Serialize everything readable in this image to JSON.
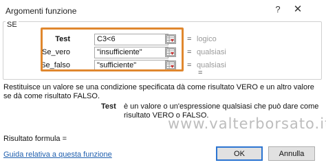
{
  "window": {
    "title": "Argomenti funzione",
    "help_glyph": "?",
    "close_glyph": "✕"
  },
  "function_group": {
    "name": "SE",
    "args": [
      {
        "label": "Test",
        "value": "C3<6",
        "result": "logico"
      },
      {
        "label": "Se_vero",
        "value": "\"insufficiente\"",
        "result": "qualsiasi"
      },
      {
        "label": "Se_falso",
        "value": "\"sufficiente\"",
        "result": "qualsiasi"
      }
    ],
    "equals": "=",
    "function_result_equals": "=",
    "highlight_color": "#e0872e"
  },
  "description": {
    "text": "Restituisce un valore se una condizione specificata dà come risultato VERO e un altro valore se dà come risultato FALSO.",
    "param_name": "Test",
    "param_text": "è un valore o un'espressione qualsiasi che può dare come risultato VERO o FALSO."
  },
  "watermark": "www.valterborsato.it",
  "footer": {
    "result_label": "Risultato formula =",
    "help_link": "Guida relativa a questa funzione",
    "ok_label": "OK",
    "cancel_label": "Annulla"
  },
  "icons": {
    "help": "help-icon",
    "close": "close-icon",
    "range_selector": "range-select-icon"
  },
  "colors": {
    "link": "#1f5fae",
    "ok_border": "#2b74d1",
    "result_text": "#9a9a9a"
  }
}
